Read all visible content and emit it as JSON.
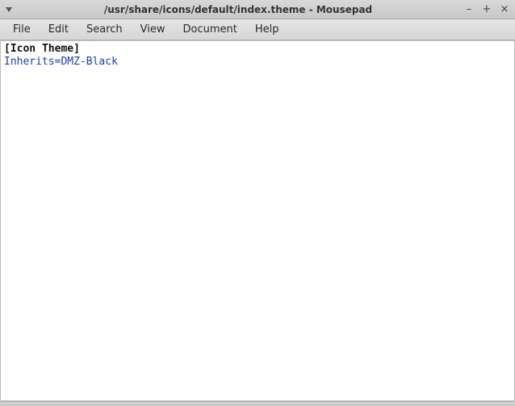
{
  "window": {
    "title": "/usr/share/icons/default/index.theme - Mousepad",
    "controls": {
      "minimize": "–",
      "maximize": "+",
      "close": "×"
    }
  },
  "menubar": {
    "items": [
      {
        "label": "File"
      },
      {
        "label": "Edit"
      },
      {
        "label": "Search"
      },
      {
        "label": "View"
      },
      {
        "label": "Document"
      },
      {
        "label": "Help"
      }
    ]
  },
  "editor": {
    "lines": [
      {
        "type": "section",
        "text": "[Icon Theme]"
      },
      {
        "type": "kv",
        "key": "Inherits",
        "eq": "=",
        "value": "DMZ-Black"
      }
    ]
  }
}
